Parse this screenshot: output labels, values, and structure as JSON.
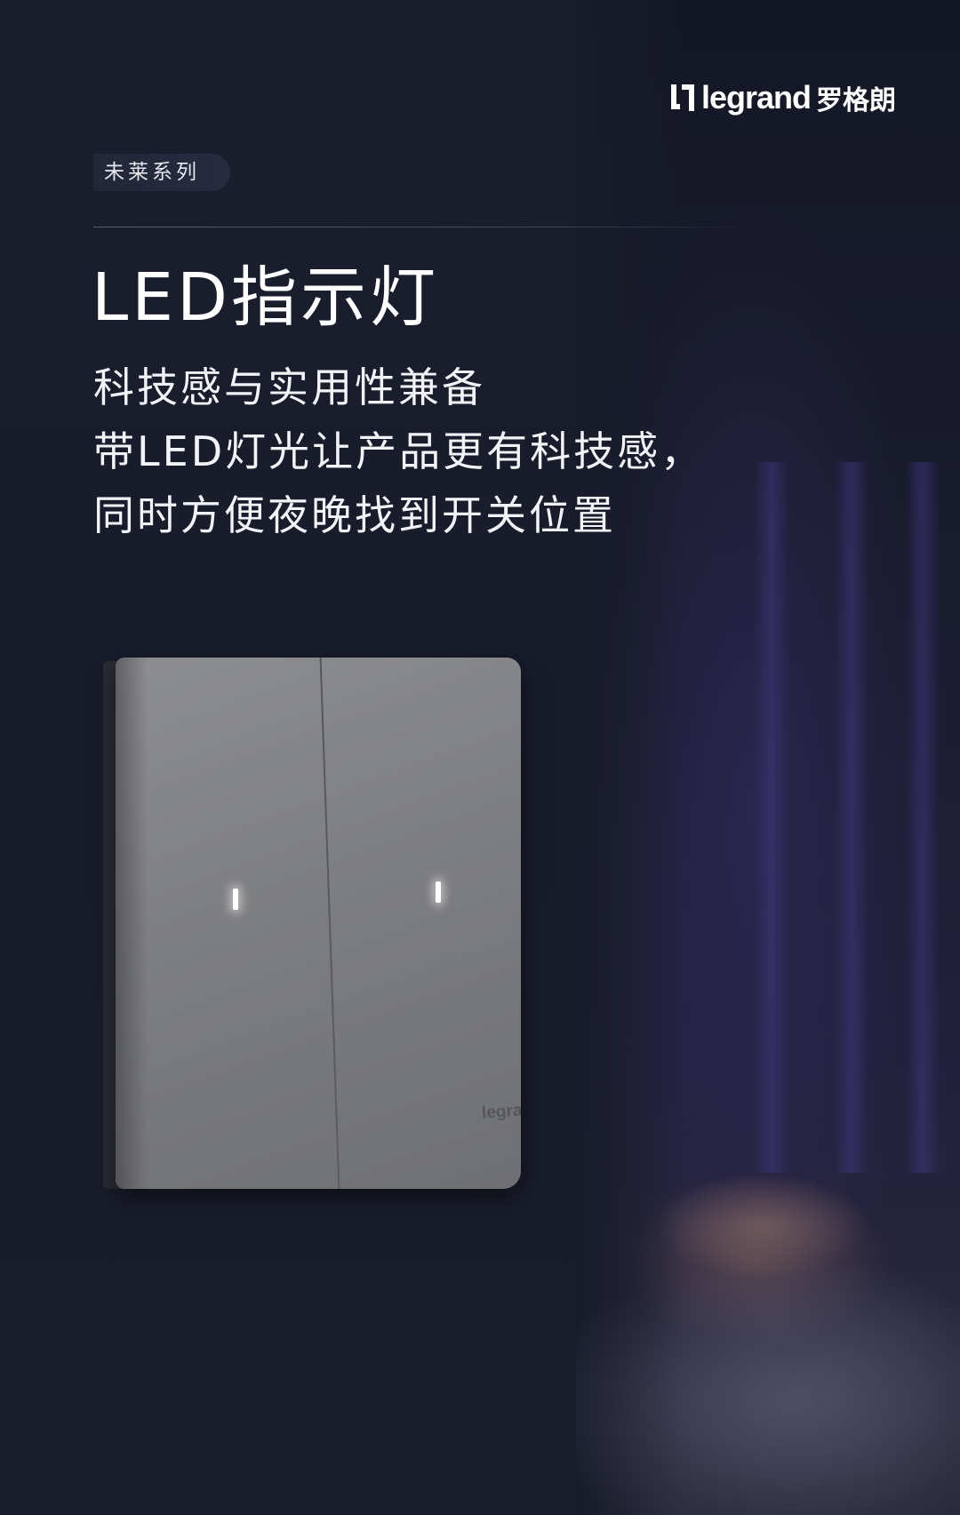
{
  "brand": {
    "logo_word": "legrand",
    "logo_cn": "罗格朗",
    "logo_icon": "legrand-logo-icon",
    "switch_brand": "legrand"
  },
  "series_tag": "未莱系列",
  "heading": "LED指示灯",
  "description": {
    "lines": [
      "科技感与实用性兼备",
      "带LED灯光让产品更有科技感，",
      "同时方便夜晚找到开关位置"
    ]
  },
  "colors": {
    "background": "#181c2a",
    "text": "#ffffff",
    "led": "#ffffff"
  }
}
